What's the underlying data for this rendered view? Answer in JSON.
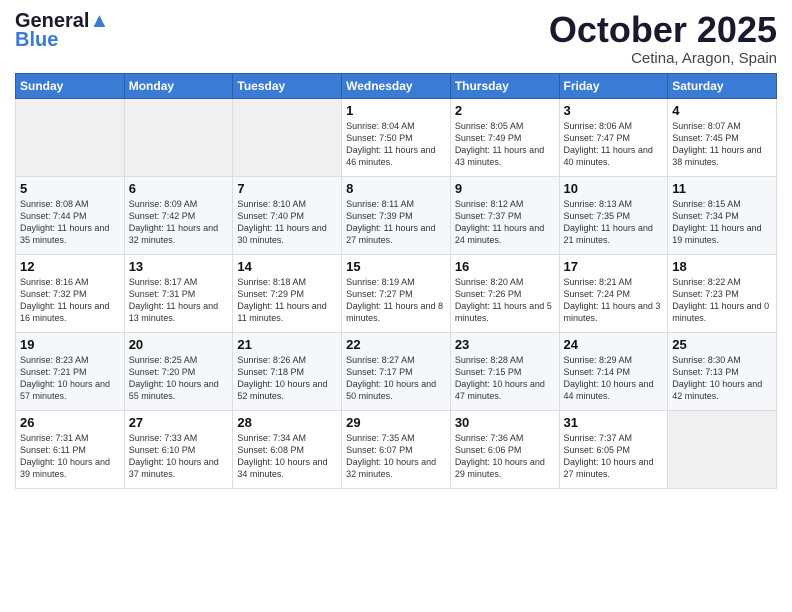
{
  "header": {
    "logo_line1": "General",
    "logo_line2": "Blue",
    "month": "October 2025",
    "location": "Cetina, Aragon, Spain"
  },
  "weekdays": [
    "Sunday",
    "Monday",
    "Tuesday",
    "Wednesday",
    "Thursday",
    "Friday",
    "Saturday"
  ],
  "weeks": [
    [
      {
        "day": "",
        "sunrise": "",
        "sunset": "",
        "daylight": ""
      },
      {
        "day": "",
        "sunrise": "",
        "sunset": "",
        "daylight": ""
      },
      {
        "day": "",
        "sunrise": "",
        "sunset": "",
        "daylight": ""
      },
      {
        "day": "1",
        "sunrise": "Sunrise: 8:04 AM",
        "sunset": "Sunset: 7:50 PM",
        "daylight": "Daylight: 11 hours and 46 minutes."
      },
      {
        "day": "2",
        "sunrise": "Sunrise: 8:05 AM",
        "sunset": "Sunset: 7:49 PM",
        "daylight": "Daylight: 11 hours and 43 minutes."
      },
      {
        "day": "3",
        "sunrise": "Sunrise: 8:06 AM",
        "sunset": "Sunset: 7:47 PM",
        "daylight": "Daylight: 11 hours and 40 minutes."
      },
      {
        "day": "4",
        "sunrise": "Sunrise: 8:07 AM",
        "sunset": "Sunset: 7:45 PM",
        "daylight": "Daylight: 11 hours and 38 minutes."
      }
    ],
    [
      {
        "day": "5",
        "sunrise": "Sunrise: 8:08 AM",
        "sunset": "Sunset: 7:44 PM",
        "daylight": "Daylight: 11 hours and 35 minutes."
      },
      {
        "day": "6",
        "sunrise": "Sunrise: 8:09 AM",
        "sunset": "Sunset: 7:42 PM",
        "daylight": "Daylight: 11 hours and 32 minutes."
      },
      {
        "day": "7",
        "sunrise": "Sunrise: 8:10 AM",
        "sunset": "Sunset: 7:40 PM",
        "daylight": "Daylight: 11 hours and 30 minutes."
      },
      {
        "day": "8",
        "sunrise": "Sunrise: 8:11 AM",
        "sunset": "Sunset: 7:39 PM",
        "daylight": "Daylight: 11 hours and 27 minutes."
      },
      {
        "day": "9",
        "sunrise": "Sunrise: 8:12 AM",
        "sunset": "Sunset: 7:37 PM",
        "daylight": "Daylight: 11 hours and 24 minutes."
      },
      {
        "day": "10",
        "sunrise": "Sunrise: 8:13 AM",
        "sunset": "Sunset: 7:35 PM",
        "daylight": "Daylight: 11 hours and 21 minutes."
      },
      {
        "day": "11",
        "sunrise": "Sunrise: 8:15 AM",
        "sunset": "Sunset: 7:34 PM",
        "daylight": "Daylight: 11 hours and 19 minutes."
      }
    ],
    [
      {
        "day": "12",
        "sunrise": "Sunrise: 8:16 AM",
        "sunset": "Sunset: 7:32 PM",
        "daylight": "Daylight: 11 hours and 16 minutes."
      },
      {
        "day": "13",
        "sunrise": "Sunrise: 8:17 AM",
        "sunset": "Sunset: 7:31 PM",
        "daylight": "Daylight: 11 hours and 13 minutes."
      },
      {
        "day": "14",
        "sunrise": "Sunrise: 8:18 AM",
        "sunset": "Sunset: 7:29 PM",
        "daylight": "Daylight: 11 hours and 11 minutes."
      },
      {
        "day": "15",
        "sunrise": "Sunrise: 8:19 AM",
        "sunset": "Sunset: 7:27 PM",
        "daylight": "Daylight: 11 hours and 8 minutes."
      },
      {
        "day": "16",
        "sunrise": "Sunrise: 8:20 AM",
        "sunset": "Sunset: 7:26 PM",
        "daylight": "Daylight: 11 hours and 5 minutes."
      },
      {
        "day": "17",
        "sunrise": "Sunrise: 8:21 AM",
        "sunset": "Sunset: 7:24 PM",
        "daylight": "Daylight: 11 hours and 3 minutes."
      },
      {
        "day": "18",
        "sunrise": "Sunrise: 8:22 AM",
        "sunset": "Sunset: 7:23 PM",
        "daylight": "Daylight: 11 hours and 0 minutes."
      }
    ],
    [
      {
        "day": "19",
        "sunrise": "Sunrise: 8:23 AM",
        "sunset": "Sunset: 7:21 PM",
        "daylight": "Daylight: 10 hours and 57 minutes."
      },
      {
        "day": "20",
        "sunrise": "Sunrise: 8:25 AM",
        "sunset": "Sunset: 7:20 PM",
        "daylight": "Daylight: 10 hours and 55 minutes."
      },
      {
        "day": "21",
        "sunrise": "Sunrise: 8:26 AM",
        "sunset": "Sunset: 7:18 PM",
        "daylight": "Daylight: 10 hours and 52 minutes."
      },
      {
        "day": "22",
        "sunrise": "Sunrise: 8:27 AM",
        "sunset": "Sunset: 7:17 PM",
        "daylight": "Daylight: 10 hours and 50 minutes."
      },
      {
        "day": "23",
        "sunrise": "Sunrise: 8:28 AM",
        "sunset": "Sunset: 7:15 PM",
        "daylight": "Daylight: 10 hours and 47 minutes."
      },
      {
        "day": "24",
        "sunrise": "Sunrise: 8:29 AM",
        "sunset": "Sunset: 7:14 PM",
        "daylight": "Daylight: 10 hours and 44 minutes."
      },
      {
        "day": "25",
        "sunrise": "Sunrise: 8:30 AM",
        "sunset": "Sunset: 7:13 PM",
        "daylight": "Daylight: 10 hours and 42 minutes."
      }
    ],
    [
      {
        "day": "26",
        "sunrise": "Sunrise: 7:31 AM",
        "sunset": "Sunset: 6:11 PM",
        "daylight": "Daylight: 10 hours and 39 minutes."
      },
      {
        "day": "27",
        "sunrise": "Sunrise: 7:33 AM",
        "sunset": "Sunset: 6:10 PM",
        "daylight": "Daylight: 10 hours and 37 minutes."
      },
      {
        "day": "28",
        "sunrise": "Sunrise: 7:34 AM",
        "sunset": "Sunset: 6:08 PM",
        "daylight": "Daylight: 10 hours and 34 minutes."
      },
      {
        "day": "29",
        "sunrise": "Sunrise: 7:35 AM",
        "sunset": "Sunset: 6:07 PM",
        "daylight": "Daylight: 10 hours and 32 minutes."
      },
      {
        "day": "30",
        "sunrise": "Sunrise: 7:36 AM",
        "sunset": "Sunset: 6:06 PM",
        "daylight": "Daylight: 10 hours and 29 minutes."
      },
      {
        "day": "31",
        "sunrise": "Sunrise: 7:37 AM",
        "sunset": "Sunset: 6:05 PM",
        "daylight": "Daylight: 10 hours and 27 minutes."
      },
      {
        "day": "",
        "sunrise": "",
        "sunset": "",
        "daylight": ""
      }
    ]
  ]
}
